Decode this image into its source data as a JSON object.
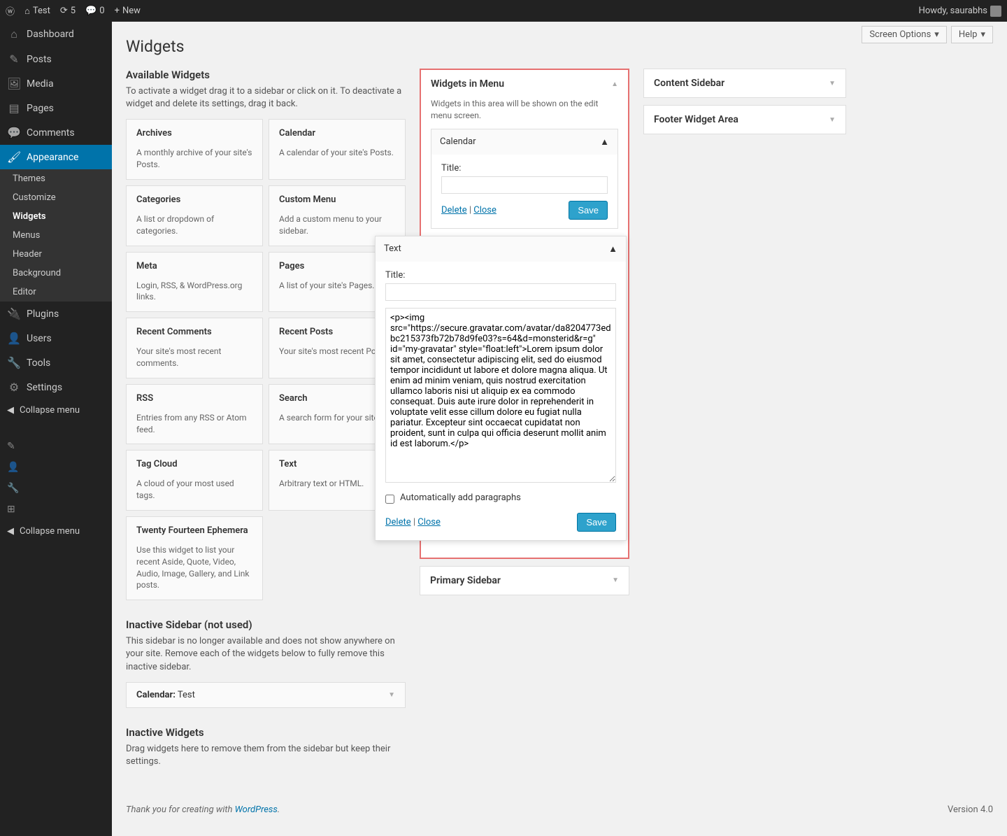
{
  "adminbar": {
    "site_name": "Test",
    "updates": "5",
    "comments": "0",
    "new": "New",
    "howdy": "Howdy, saurabhs"
  },
  "sidebar_menu": [
    {
      "label": "Dashboard",
      "icon": "⌂"
    },
    {
      "label": "Posts",
      "icon": "✎"
    },
    {
      "label": "Media",
      "icon": "🖼"
    },
    {
      "label": "Pages",
      "icon": "▤"
    },
    {
      "label": "Comments",
      "icon": "💬"
    },
    {
      "label": "Appearance",
      "icon": "🖌",
      "active": true,
      "submenu": [
        {
          "label": "Themes"
        },
        {
          "label": "Customize"
        },
        {
          "label": "Widgets",
          "current": true
        },
        {
          "label": "Menus"
        },
        {
          "label": "Header"
        },
        {
          "label": "Background"
        },
        {
          "label": "Editor"
        }
      ]
    },
    {
      "label": "Plugins",
      "icon": "🔌"
    },
    {
      "label": "Users",
      "icon": "👤"
    },
    {
      "label": "Tools",
      "icon": "🔧"
    },
    {
      "label": "Settings",
      "icon": "⚙"
    }
  ],
  "collapse": "Collapse menu",
  "screen_options": "Screen Options",
  "help": "Help",
  "page_title": "Widgets",
  "available": {
    "heading": "Available Widgets",
    "desc": "To activate a widget drag it to a sidebar or click on it. To deactivate a widget and delete its settings, drag it back.",
    "widgets": [
      {
        "name": "Archives",
        "desc": "A monthly archive of your site's Posts."
      },
      {
        "name": "Calendar",
        "desc": "A calendar of your site's Posts."
      },
      {
        "name": "Categories",
        "desc": "A list or dropdown of categories."
      },
      {
        "name": "Custom Menu",
        "desc": "Add a custom menu to your sidebar."
      },
      {
        "name": "Meta",
        "desc": "Login, RSS, & WordPress.org links."
      },
      {
        "name": "Pages",
        "desc": "A list of your site's Pages."
      },
      {
        "name": "Recent Comments",
        "desc": "Your site's most recent comments."
      },
      {
        "name": "Recent Posts",
        "desc": "Your site's most recent Posts."
      },
      {
        "name": "RSS",
        "desc": "Entries from any RSS or Atom feed."
      },
      {
        "name": "Search",
        "desc": "A search form for your site."
      },
      {
        "name": "Tag Cloud",
        "desc": "A cloud of your most used tags."
      },
      {
        "name": "Text",
        "desc": "Arbitrary text or HTML."
      },
      {
        "name": "Twenty Fourteen Ephemera",
        "desc": "Use this widget to list your recent Aside, Quote, Video, Audio, Image, Gallery, and Link posts."
      }
    ]
  },
  "inactive_sidebar": {
    "heading": "Inactive Sidebar (not used)",
    "desc": "This sidebar is no longer available and does not show anywhere on your site. Remove each of the widgets below to fully remove this inactive sidebar.",
    "widget_name": "Calendar:",
    "widget_suffix": " Test"
  },
  "inactive_widgets": {
    "heading": "Inactive Widgets",
    "desc": "Drag widgets here to remove them from the sidebar but keep their settings."
  },
  "widget_area": {
    "title": "Widgets in Menu",
    "hint": "Widgets in this area will be shown on the edit menu screen.",
    "calendar": {
      "name": "Calendar",
      "title_label": "Title:",
      "title_value": "",
      "delete": "Delete",
      "close": "Close",
      "save": "Save"
    },
    "text": {
      "name": "Text",
      "title_label": "Title:",
      "title_value": "",
      "content": "<p><img src=\"https://secure.gravatar.com/avatar/da8204773edbc215373fb72b78d9fe03?s=64&d=monsterid&r=g\" id=\"my-gravatar\" style=\"float:left\">Lorem ipsum dolor sit amet, consectetur adipiscing elit, sed do eiusmod tempor incididunt ut labore et dolore magna aliqua. Ut enim ad minim veniam, quis nostrud exercitation ullamco laboris nisi ut aliquip ex ea commodo consequat. Duis aute irure dolor in reprehenderit in voluptate velit esse cillum dolore eu fugiat nulla pariatur. Excepteur sint occaecat cupidatat non proident, sunt in culpa qui officia deserunt mollit anim id est laborum.</p>",
      "autop": "Automatically add paragraphs",
      "delete": "Delete",
      "close": "Close",
      "save": "Save"
    }
  },
  "primary_sidebar": "Primary Sidebar",
  "other_areas": [
    {
      "name": "Content Sidebar"
    },
    {
      "name": "Footer Widget Area"
    }
  ],
  "footer": {
    "thanks": "Thank you for creating with ",
    "wp": "WordPress",
    "version": "Version 4.0"
  }
}
